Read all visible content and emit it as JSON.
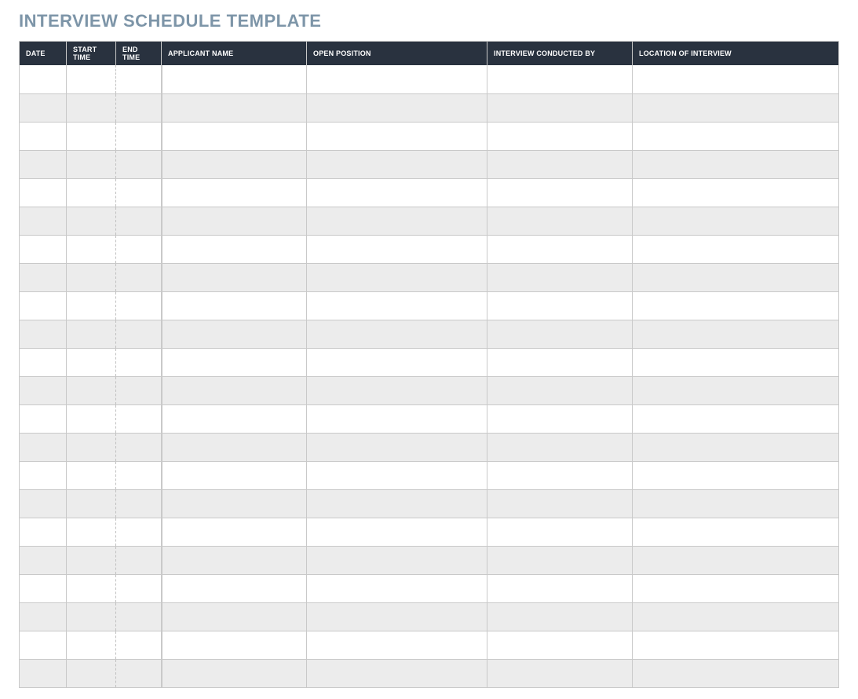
{
  "title": "INTERVIEW SCHEDULE TEMPLATE",
  "columns": [
    "DATE",
    "START TIME",
    "END TIME",
    "APPLICANT NAME",
    "OPEN POSITION",
    "INTERVIEW CONDUCTED BY",
    "LOCATION OF INTERVIEW"
  ],
  "rows": [
    {
      "date": "",
      "start_time": "",
      "end_time": "",
      "applicant_name": "",
      "open_position": "",
      "conducted_by": "",
      "location": ""
    },
    {
      "date": "",
      "start_time": "",
      "end_time": "",
      "applicant_name": "",
      "open_position": "",
      "conducted_by": "",
      "location": ""
    },
    {
      "date": "",
      "start_time": "",
      "end_time": "",
      "applicant_name": "",
      "open_position": "",
      "conducted_by": "",
      "location": ""
    },
    {
      "date": "",
      "start_time": "",
      "end_time": "",
      "applicant_name": "",
      "open_position": "",
      "conducted_by": "",
      "location": ""
    },
    {
      "date": "",
      "start_time": "",
      "end_time": "",
      "applicant_name": "",
      "open_position": "",
      "conducted_by": "",
      "location": ""
    },
    {
      "date": "",
      "start_time": "",
      "end_time": "",
      "applicant_name": "",
      "open_position": "",
      "conducted_by": "",
      "location": ""
    },
    {
      "date": "",
      "start_time": "",
      "end_time": "",
      "applicant_name": "",
      "open_position": "",
      "conducted_by": "",
      "location": ""
    },
    {
      "date": "",
      "start_time": "",
      "end_time": "",
      "applicant_name": "",
      "open_position": "",
      "conducted_by": "",
      "location": ""
    },
    {
      "date": "",
      "start_time": "",
      "end_time": "",
      "applicant_name": "",
      "open_position": "",
      "conducted_by": "",
      "location": ""
    },
    {
      "date": "",
      "start_time": "",
      "end_time": "",
      "applicant_name": "",
      "open_position": "",
      "conducted_by": "",
      "location": ""
    },
    {
      "date": "",
      "start_time": "",
      "end_time": "",
      "applicant_name": "",
      "open_position": "",
      "conducted_by": "",
      "location": ""
    },
    {
      "date": "",
      "start_time": "",
      "end_time": "",
      "applicant_name": "",
      "open_position": "",
      "conducted_by": "",
      "location": ""
    },
    {
      "date": "",
      "start_time": "",
      "end_time": "",
      "applicant_name": "",
      "open_position": "",
      "conducted_by": "",
      "location": ""
    },
    {
      "date": "",
      "start_time": "",
      "end_time": "",
      "applicant_name": "",
      "open_position": "",
      "conducted_by": "",
      "location": ""
    },
    {
      "date": "",
      "start_time": "",
      "end_time": "",
      "applicant_name": "",
      "open_position": "",
      "conducted_by": "",
      "location": ""
    },
    {
      "date": "",
      "start_time": "",
      "end_time": "",
      "applicant_name": "",
      "open_position": "",
      "conducted_by": "",
      "location": ""
    },
    {
      "date": "",
      "start_time": "",
      "end_time": "",
      "applicant_name": "",
      "open_position": "",
      "conducted_by": "",
      "location": ""
    },
    {
      "date": "",
      "start_time": "",
      "end_time": "",
      "applicant_name": "",
      "open_position": "",
      "conducted_by": "",
      "location": ""
    },
    {
      "date": "",
      "start_time": "",
      "end_time": "",
      "applicant_name": "",
      "open_position": "",
      "conducted_by": "",
      "location": ""
    },
    {
      "date": "",
      "start_time": "",
      "end_time": "",
      "applicant_name": "",
      "open_position": "",
      "conducted_by": "",
      "location": ""
    },
    {
      "date": "",
      "start_time": "",
      "end_time": "",
      "applicant_name": "",
      "open_position": "",
      "conducted_by": "",
      "location": ""
    },
    {
      "date": "",
      "start_time": "",
      "end_time": "",
      "applicant_name": "",
      "open_position": "",
      "conducted_by": "",
      "location": ""
    }
  ]
}
